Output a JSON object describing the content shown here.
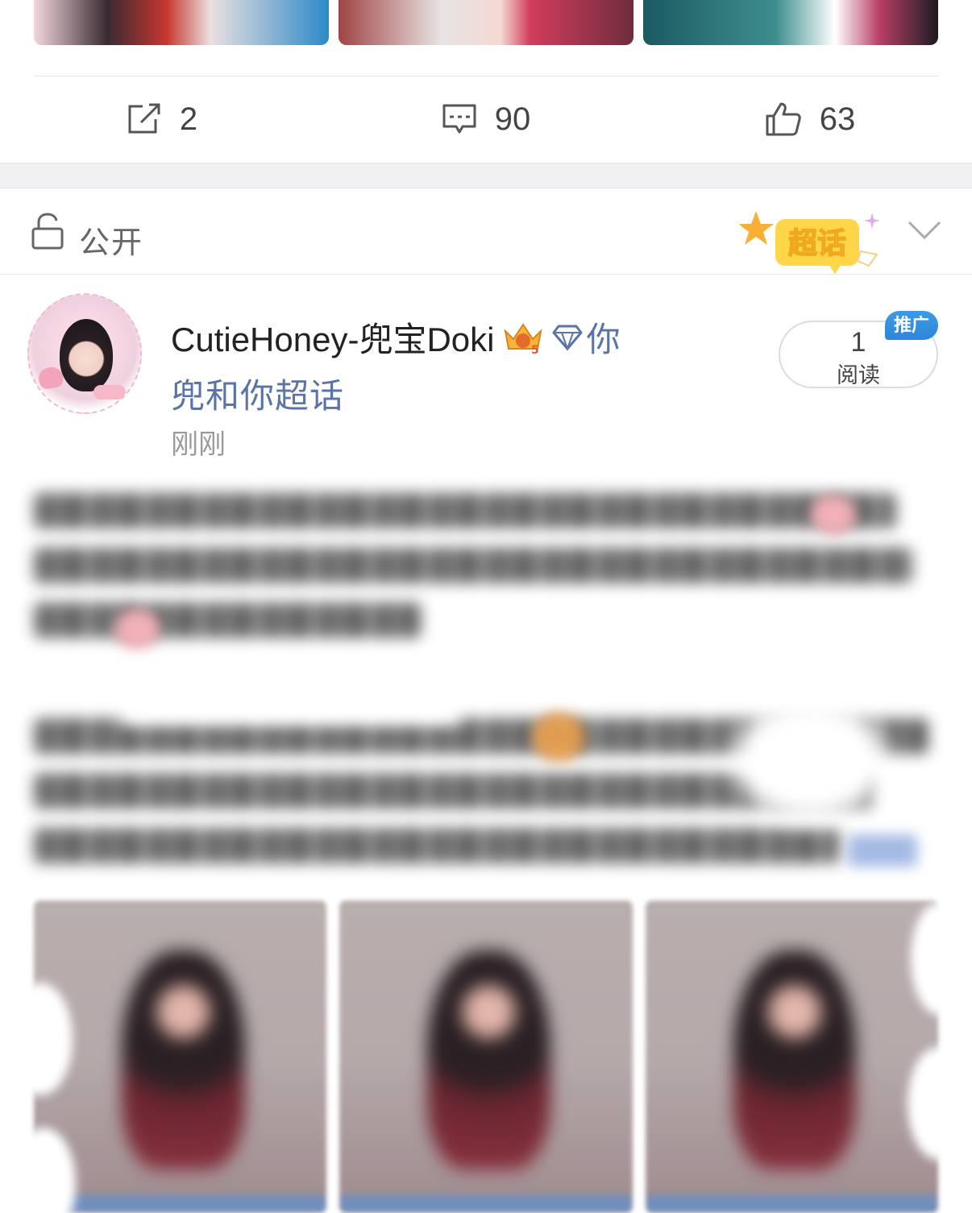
{
  "previous_post": {
    "actions": {
      "repost_count": "2",
      "comment_count": "90",
      "like_count": "63"
    }
  },
  "visibility": {
    "label": "公开",
    "badge_text": "超话"
  },
  "post": {
    "author_name": "CutieHoney-兜宝Doki",
    "topic_part1": "你",
    "topic_part2": "兜和你超话",
    "time": "刚刚",
    "read_count": "1",
    "read_label": "阅读",
    "promo_tag": "推广"
  },
  "colors": {
    "link_blue": "#5a73a8",
    "promo_blue": "#2f86d6",
    "separator_gray": "#f1f1f3"
  }
}
